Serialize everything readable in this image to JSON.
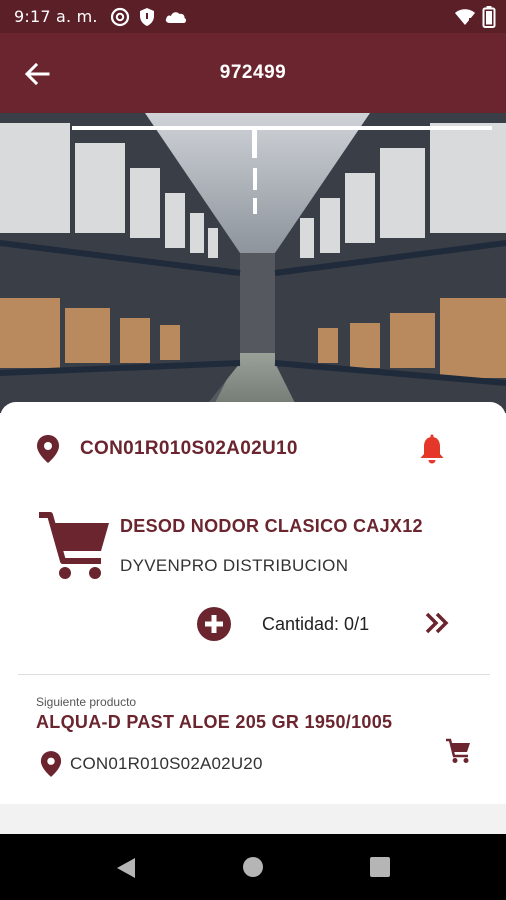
{
  "status_bar": {
    "time": "9:17 a. m.",
    "icons": [
      "at-sign-icon",
      "shield-icon",
      "cloud-icon",
      "wifi-icon",
      "battery-icon"
    ]
  },
  "app_bar": {
    "title": "972499",
    "back_icon": "arrow-left-icon"
  },
  "hero": {
    "image": "warehouse aisle photo",
    "progress": 1.0
  },
  "current_task": {
    "location": "CON01R010S02A02U10",
    "product_name": "DESOD NODOR CLASICO CAJX12",
    "supplier": "DYVENPRO DISTRIBUCION",
    "quantity_label": "Cantidad: 0/1"
  },
  "next_product": {
    "label": "Siguiente producto",
    "name": "ALQUA-D PAST ALOE 205 GR 1950/1005",
    "location": "CON01R010S02A02U20"
  },
  "colors": {
    "primary": "#6b252e",
    "status_bar": "#5a1f27",
    "accent_alert": "#e5362a"
  }
}
